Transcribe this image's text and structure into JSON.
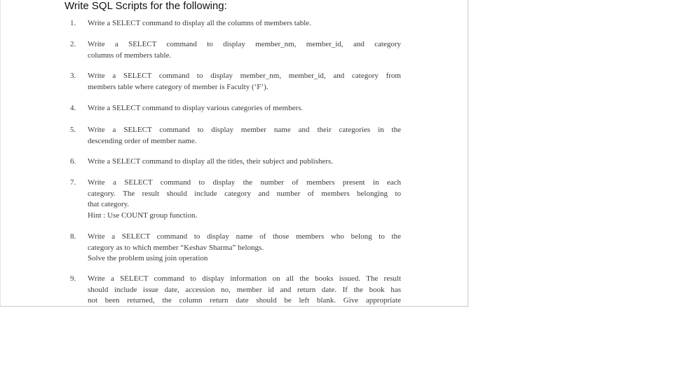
{
  "heading": "Write SQL Scripts for the following:",
  "questions": [
    {
      "num": "1.",
      "lines": [
        "Write a SELECT command to display all the columns of members table."
      ]
    },
    {
      "num": "2.",
      "lines": [
        "Write a SELECT command to display member_nm,  member_id, and category",
        "columns of members table."
      ]
    },
    {
      "num": "3.",
      "lines": [
        "Write a SELECT command to display member_nm, member_id, and category from",
        "members table where category of member is Faculty (‘F’)."
      ]
    },
    {
      "num": "4.",
      "lines": [
        "Write a SELECT command to display various categories of members."
      ]
    },
    {
      "num": "5.",
      "lines": [
        "Write a SELECT command to display member name and their categories in the",
        "descending order of member name."
      ]
    },
    {
      "num": "6.",
      "lines": [
        "Write a SELECT command to display all the titles, their subject and publishers."
      ]
    },
    {
      "num": "7.",
      "lines": [
        "Write a SELECT command to display the number of members present in each",
        "category. The result should include category and number of members belonging to",
        "that category.",
        "Hint : Use COUNT group function."
      ]
    },
    {
      "num": "8.",
      "lines": [
        "Write a SELECT command to display  name of those members who belong to the",
        "category as to which member “Keshav Sharma” belongs.",
        "Solve the problem using join operation"
      ]
    },
    {
      "num": "9.",
      "lines": [
        "Write a SELECT command to display information on all the books issued. The result",
        "should include issue date, accession no, member id and return date. If the book has",
        "not been returned, the column return date should be left blank. Give appropriate"
      ]
    }
  ]
}
